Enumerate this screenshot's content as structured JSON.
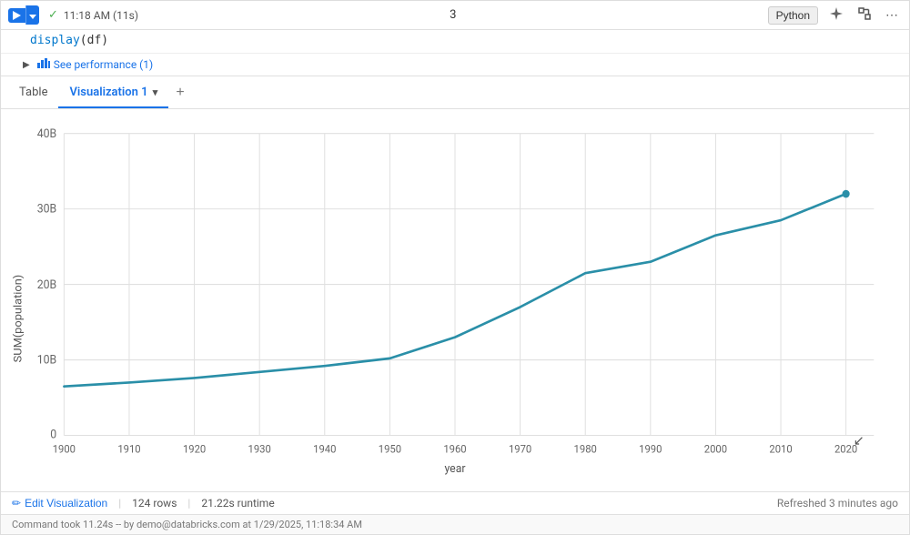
{
  "toolbar": {
    "time": "11:18 AM (11s)",
    "cell_number": "3",
    "python_label": "Python",
    "ai_icon": "✦",
    "expand_icon": "⤢",
    "more_icon": "⋯"
  },
  "code": {
    "line": "display(df)"
  },
  "performance": {
    "label": "See performance (1)"
  },
  "tabs": {
    "table_label": "Table",
    "viz_label": "Visualization 1",
    "add_label": "+"
  },
  "chart": {
    "y_axis_label": "SUM(population)",
    "x_axis_label": "year",
    "y_ticks": [
      "40B",
      "30B",
      "20B",
      "10B",
      "0"
    ],
    "x_ticks": [
      "1900",
      "1910",
      "1920",
      "1930",
      "1940",
      "1950",
      "1960",
      "1970",
      "1980",
      "1990",
      "2000",
      "2010",
      "2020"
    ],
    "line_color": "#2a8fa8",
    "data_points": [
      {
        "year": 1900,
        "value": 6.5
      },
      {
        "year": 1910,
        "value": 7.0
      },
      {
        "year": 1920,
        "value": 7.6
      },
      {
        "year": 1930,
        "value": 8.4
      },
      {
        "year": 1940,
        "value": 9.2
      },
      {
        "year": 1950,
        "value": 10.2
      },
      {
        "year": 1960,
        "value": 13.0
      },
      {
        "year": 1970,
        "value": 17.0
      },
      {
        "year": 1980,
        "value": 21.5
      },
      {
        "year": 1990,
        "value": 23.0
      },
      {
        "year": 2000,
        "value": 26.5
      },
      {
        "year": 2010,
        "value": 28.5
      },
      {
        "year": 2020,
        "value": 32.0
      }
    ]
  },
  "status": {
    "edit_viz_label": "Edit Visualization",
    "rows": "124 rows",
    "runtime": "21.22s runtime",
    "refreshed": "Refreshed 3 minutes ago"
  },
  "footer": {
    "command": "Command took 11.24s -- by demo@databricks.com at 1/29/2025, 11:18:34 AM"
  },
  "icons": {
    "play": "▶",
    "check": "✓",
    "chart_bar": "📊",
    "pencil": "✏"
  }
}
